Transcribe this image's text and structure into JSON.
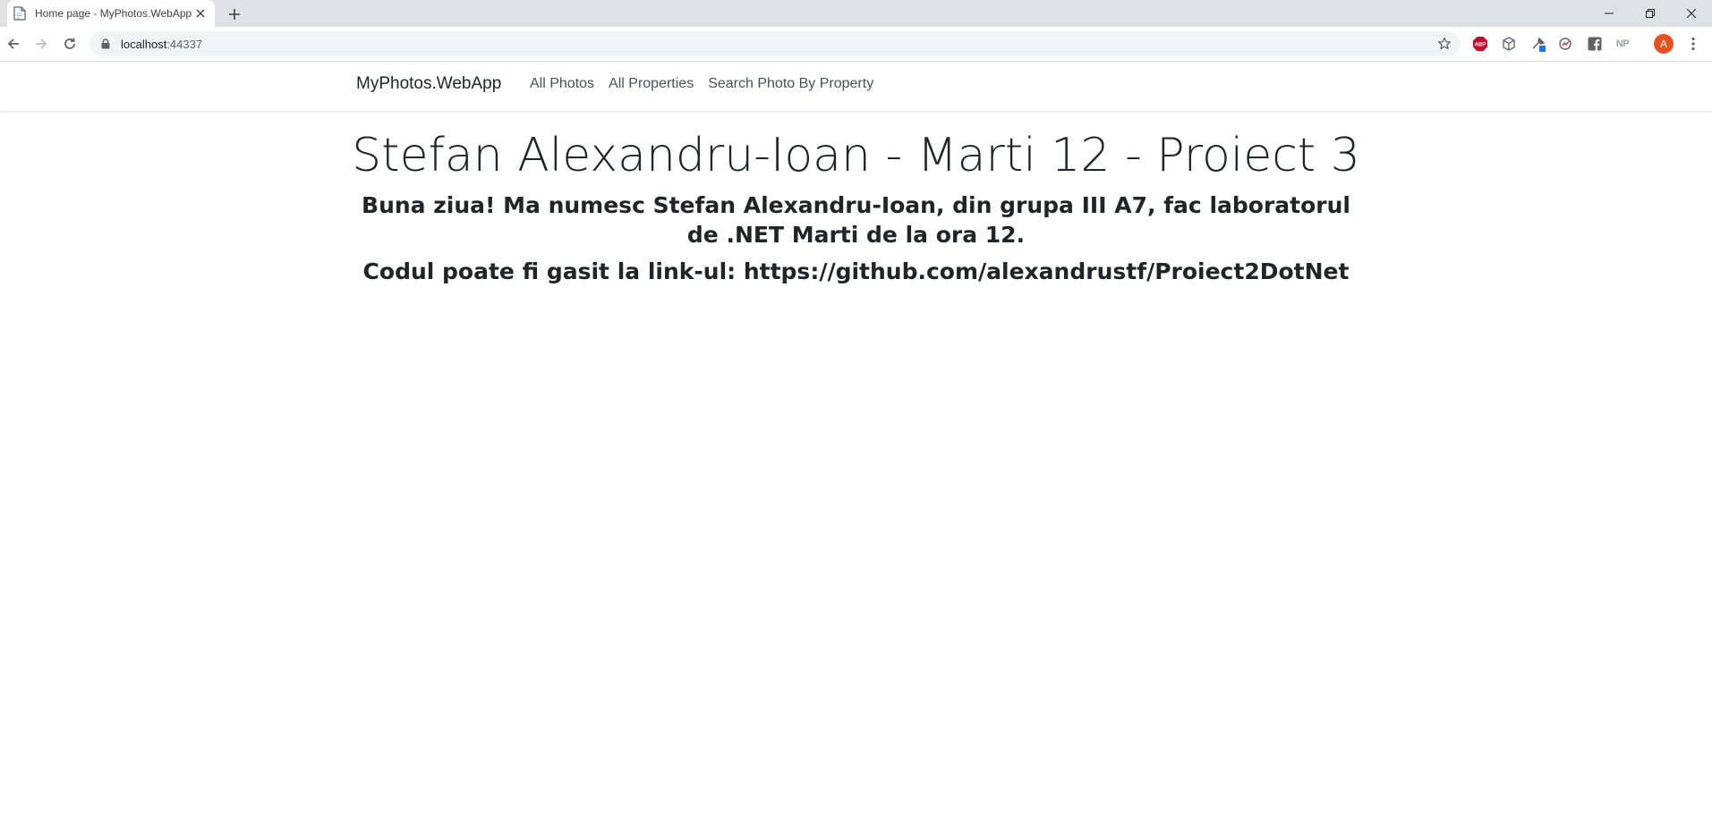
{
  "browser": {
    "tab_title": "Home page - MyPhotos.WebApp",
    "url_host": "localhost",
    "url_port": ":44337",
    "extensions": {
      "abp": "ABP",
      "np": "NP"
    },
    "profile_initial": "A"
  },
  "site": {
    "brand": "MyPhotos.WebApp",
    "nav": [
      {
        "label": "All Photos"
      },
      {
        "label": "All Properties"
      },
      {
        "label": "Search Photo By Property"
      }
    ]
  },
  "main": {
    "heading": "Stefan Alexandru-Ioan - Marti 12 - Proiect 3",
    "intro": "Buna ziua! Ma numesc Stefan Alexandru-Ioan, din grupa III A7, fac laboratorul de .NET Marti de la ora 12.",
    "code_line": "Codul poate fi gasit la link-ul: https://github.com/alexandrustf/Proiect2DotNet"
  }
}
